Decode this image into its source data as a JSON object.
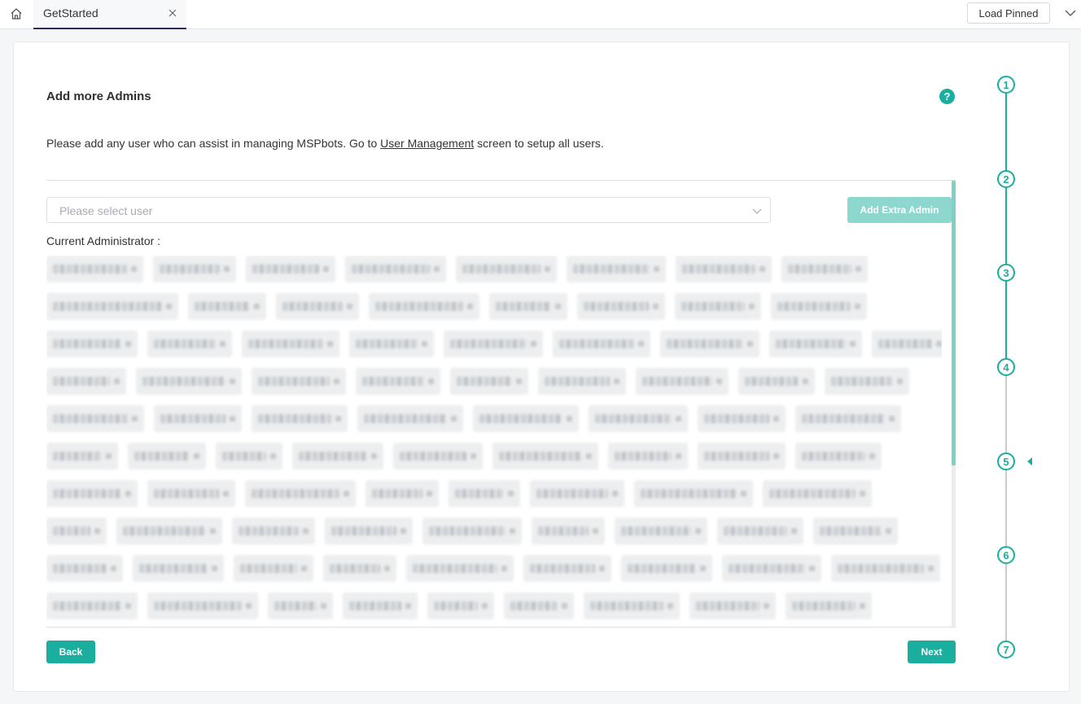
{
  "topbar": {
    "tab_label": "GetStarted",
    "load_pinned_label": "Load Pinned"
  },
  "main": {
    "title": "Add more Admins",
    "desc_before": "Please add any user who can assist in managing MSPbots. Go to ",
    "desc_link": "User Management",
    "desc_after": " screen to setup all users.",
    "select_placeholder": "Please select user",
    "add_admin_label": "Add Extra Admin",
    "current_admin_label": "Current Administrator :",
    "back_label": "Back",
    "next_label": "Next"
  },
  "steps": [
    "1",
    "2",
    "3",
    "4",
    "5",
    "6",
    "7"
  ],
  "colors": {
    "accent": "#1aae9f",
    "accent_light": "#8dd7cf",
    "tab_underline": "#2d2b5c"
  }
}
